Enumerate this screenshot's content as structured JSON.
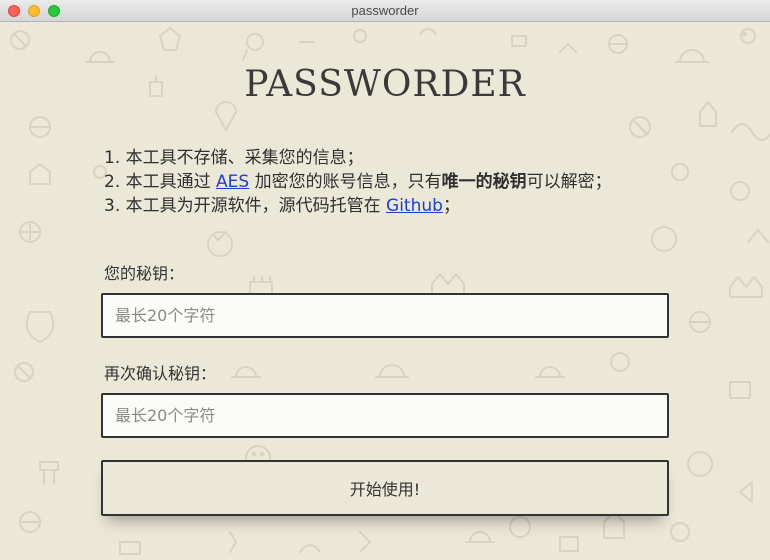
{
  "window": {
    "title": "passworder"
  },
  "app": {
    "title": "PASSWORDER"
  },
  "notes": [
    {
      "text": "1. 本工具不存储、采集您的信息；"
    },
    {
      "before": "2. 本工具通过 ",
      "link": "AES",
      "middle": " 加密您的账号信息，只有",
      "bold": "唯一的秘钥",
      "after": "可以解密；"
    },
    {
      "before": "3. 本工具为开源软件，源代码托管在 ",
      "link": "Github",
      "after": "；"
    }
  ],
  "form": {
    "key_label": "您的秘钥：",
    "key_placeholder": "最长20个字符",
    "confirm_label": "再次确认秘钥：",
    "confirm_placeholder": "最长20个字符",
    "start_label": "开始使用!"
  },
  "colors": {
    "background": "#ece8d8",
    "link": "#1a3fd1",
    "text": "#2f2f2f"
  }
}
